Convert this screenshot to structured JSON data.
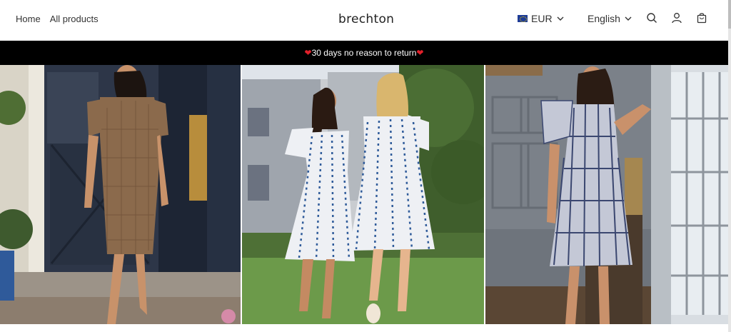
{
  "nav": {
    "home": "Home",
    "all_products": "All products"
  },
  "brand": {
    "logo_text": "brechton"
  },
  "header": {
    "currency_label": "EUR",
    "language_label": "English",
    "icons": [
      "search-icon",
      "account-icon",
      "cart-icon"
    ]
  },
  "announcement": {
    "text": "30 days no reason to return",
    "heart_color": "#e3202a"
  },
  "gallery": {
    "images": [
      {
        "name": "brown-check-dress-photo"
      },
      {
        "name": "blue-floral-dresses-photo"
      },
      {
        "name": "plaid-puff-sleeve-dress-photo"
      }
    ]
  },
  "colors": {
    "announcement_bg": "#000000",
    "text": "#222222"
  }
}
